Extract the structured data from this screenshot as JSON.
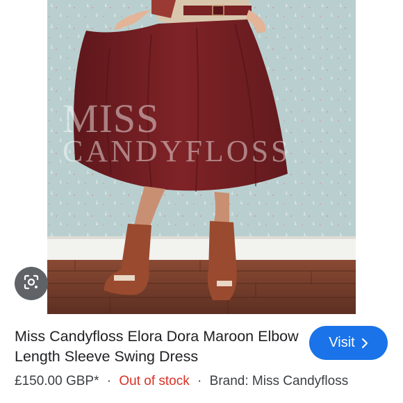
{
  "image": {
    "watermark": "MISS CANDYFLOSS"
  },
  "lens": {
    "icon": "google-lens-icon"
  },
  "product": {
    "title": "Miss Candyfloss Elora Dora Maroon Elbow Length Sleeve Swing Dress",
    "price": "£150.00 GBP*",
    "separator": "·",
    "stock_status": "Out of stock",
    "brand": "Brand: Miss Candyfloss"
  },
  "visit": {
    "label": "Visit",
    "icon": "chevron-right-icon"
  },
  "colors": {
    "accent": "#1a73e8",
    "out_of_stock": "#d93025",
    "dress": "#7a2124",
    "wallpaper": "#b9cfcf"
  }
}
